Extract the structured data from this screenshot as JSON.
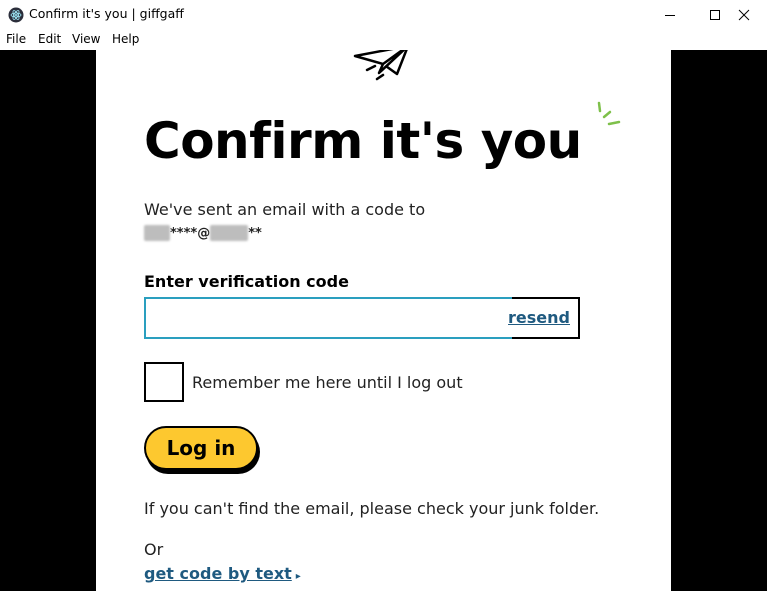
{
  "window": {
    "title": "Confirm it's you | giffgaff",
    "controls": [
      "minimize-icon",
      "maximize-icon",
      "close-icon"
    ]
  },
  "menu": {
    "items": [
      "File",
      "Edit",
      "View",
      "Help"
    ]
  },
  "page": {
    "title": "Confirm it's you",
    "sent_text": "We've sent an email with a code to",
    "masked_email_visible": "****@",
    "masked_email_suffix": "**",
    "code_label": "Enter verification code",
    "code_value": "",
    "resend_label": "resend",
    "remember_label": "Remember me here until I log out",
    "remember_checked": false,
    "login_label": "Log in",
    "junk_text": "If you can't find the email, please check your junk folder.",
    "or_text": "Or",
    "text_link_label": "get code by text"
  },
  "colors": {
    "button_yellow": "#fdc82f",
    "link_blue": "#1f5a80",
    "focus_teal": "#2a9fbf",
    "sparkle_green": "#7ec04a",
    "side_background": "#000000"
  }
}
